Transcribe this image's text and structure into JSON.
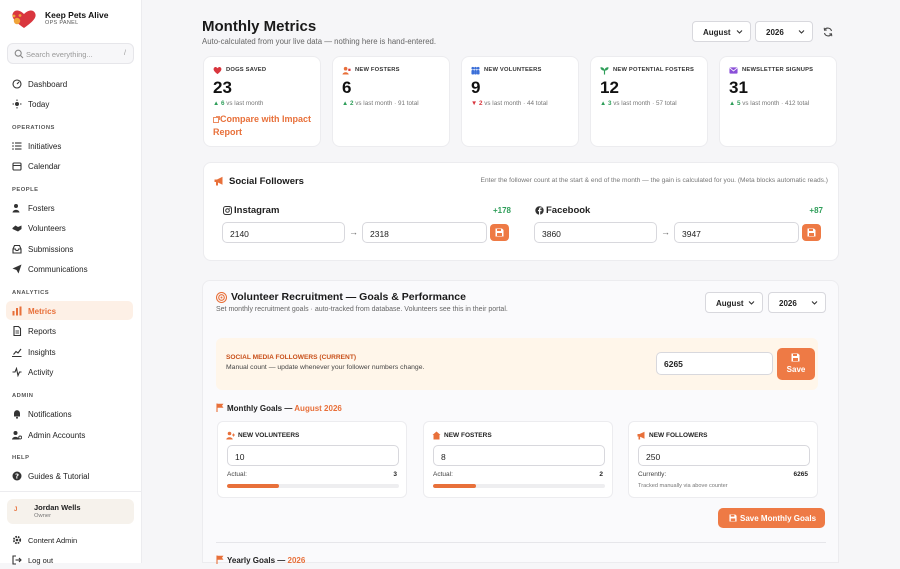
{
  "brand": {
    "name": "Keep Pets Alive",
    "subtitle": "OPS PANEL"
  },
  "search": {
    "placeholder": "Search everything...",
    "shortcut": "/"
  },
  "nav": {
    "top": [
      {
        "label": "Dashboard",
        "icon": "dashboard-icon"
      },
      {
        "label": "Today",
        "icon": "sun-icon"
      }
    ],
    "sections": [
      {
        "title": "OPERATIONS",
        "items": [
          {
            "label": "Initiatives"
          },
          {
            "label": "Calendar"
          }
        ]
      },
      {
        "title": "PEOPLE",
        "items": [
          {
            "label": "Fosters"
          },
          {
            "label": "Volunteers"
          },
          {
            "label": "Submissions"
          },
          {
            "label": "Communications"
          }
        ]
      },
      {
        "title": "ANALYTICS",
        "items": [
          {
            "label": "Metrics",
            "active": true
          },
          {
            "label": "Reports"
          },
          {
            "label": "Insights"
          },
          {
            "label": "Activity"
          }
        ]
      },
      {
        "title": "ADMIN",
        "items": [
          {
            "label": "Notifications"
          },
          {
            "label": "Admin Accounts"
          }
        ]
      },
      {
        "title": "HELP",
        "items": [
          {
            "label": "Guides & Tutorial"
          }
        ]
      }
    ]
  },
  "user": {
    "initial": "J",
    "name": "Jordan Wells",
    "role": "Owner"
  },
  "footer_links": [
    {
      "label": "Content Admin"
    },
    {
      "label": "Log out"
    }
  ],
  "header": {
    "title": "Monthly Metrics",
    "subtitle": "Auto-calculated from your live data — nothing here is hand-entered.",
    "month": "August",
    "year": "2026"
  },
  "stats": [
    {
      "label": "DOGS SAVED",
      "value": "23",
      "arrow": "▲",
      "delta": "6",
      "suffix": " vs last month",
      "trend": "up",
      "link": "Compare with Impact Report",
      "color": "#d9363e"
    },
    {
      "label": "NEW FOSTERS",
      "value": "6",
      "arrow": "▲",
      "delta": "2",
      "suffix": " vs last month · 91 total",
      "trend": "up",
      "color": "#e8703a"
    },
    {
      "label": "NEW VOLUNTEERS",
      "value": "9",
      "arrow": "▼",
      "delta": "2",
      "suffix": " vs last month · 44 total",
      "trend": "down",
      "color": "#3b6fd8"
    },
    {
      "label": "NEW POTENTIAL FOSTERS",
      "value": "12",
      "arrow": "▲",
      "delta": "3",
      "suffix": " vs last month · 57 total",
      "trend": "up",
      "color": "#2f9e5a"
    },
    {
      "label": "NEWSLETTER SIGNUPS",
      "value": "31",
      "arrow": "▲",
      "delta": "5",
      "suffix": " vs last month · 412 total",
      "trend": "up",
      "color": "#8a4fd8"
    }
  ],
  "social": {
    "title": "Social Followers",
    "note": "Enter the follower count at the start & end of the month — the gain is calculated for you. (Meta blocks automatic reads.)",
    "platforms": [
      {
        "name": "Instagram",
        "gain": "+178",
        "start": "2140",
        "end": "2318"
      },
      {
        "name": "Facebook",
        "gain": "+87",
        "start": "3860",
        "end": "3947"
      }
    ]
  },
  "recruit": {
    "title": "Volunteer Recruitment — Goals & Performance",
    "subtitle": "Set monthly recruitment goals · auto-tracked from database. Volunteers see this in their portal.",
    "month": "August",
    "year": "2026",
    "banner": {
      "title": "SOCIAL MEDIA FOLLOWERS (CURRENT)",
      "text": "Manual count — update whenever your follower numbers change.",
      "value": "6265",
      "save": "Save"
    },
    "monthly_label": "Monthly Goals —",
    "monthly_period": "August 2026",
    "goals": [
      {
        "label": "NEW VOLUNTEERS",
        "goal": "10",
        "actual_label": "Actual:",
        "actual": "3",
        "progress": 0.3
      },
      {
        "label": "NEW FOSTERS",
        "goal": "8",
        "actual_label": "Actual:",
        "actual": "2",
        "progress": 0.25
      },
      {
        "label": "NEW FOLLOWERS",
        "goal": "250",
        "actual_label": "Currently:",
        "actual": "6265",
        "tracked": "Tracked manually via above counter"
      }
    ],
    "save_goals": "Save Monthly Goals",
    "yearly_label": "Yearly Goals —",
    "yearly_period": "2026"
  }
}
